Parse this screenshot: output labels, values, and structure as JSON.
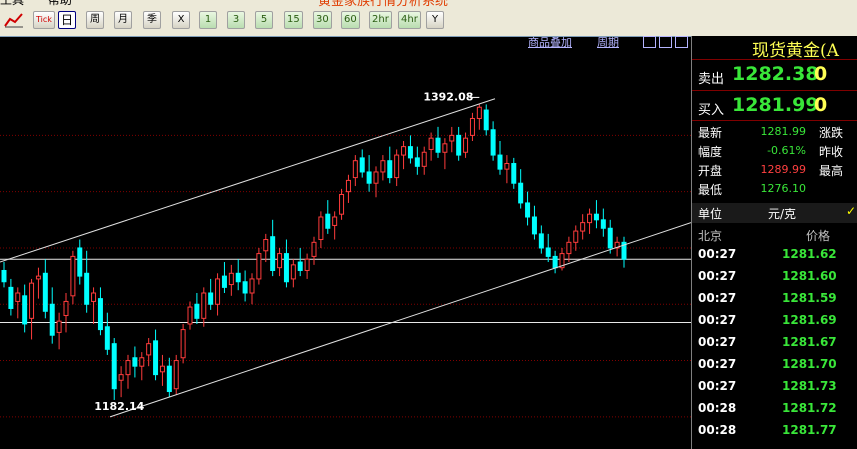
{
  "app": {
    "title": "黄金家族行情分析系统",
    "menu": [
      "工具",
      "帮助"
    ]
  },
  "toolbar": {
    "buttons": [
      {
        "label": "Tick",
        "name": "tick-button"
      },
      {
        "label": "日",
        "name": "period-day-button",
        "selected": true
      },
      {
        "label": "周",
        "name": "period-week-button"
      },
      {
        "label": "月",
        "name": "period-month-button"
      },
      {
        "label": "季",
        "name": "period-quarter-button"
      },
      {
        "label": "X",
        "name": "period-custom-button"
      },
      {
        "label": "1",
        "name": "period-1min-button"
      },
      {
        "label": "3",
        "name": "period-3min-button"
      },
      {
        "label": "5",
        "name": "period-5min-button"
      },
      {
        "label": "15",
        "name": "period-15min-button"
      },
      {
        "label": "30",
        "name": "period-30min-button"
      },
      {
        "label": "60",
        "name": "period-60min-button"
      },
      {
        "label": "2hr",
        "name": "period-2hr-button"
      },
      {
        "label": "4hr",
        "name": "period-4hr-button"
      },
      {
        "label": "Y",
        "name": "period-year-button"
      }
    ]
  },
  "chart_header": {
    "overlay_link": "商品叠加",
    "period_link": "周期"
  },
  "chart_data": {
    "type": "candlestick",
    "high_label": "1392.08",
    "low_label": "1182.14",
    "ylim": [
      1150,
      1420
    ],
    "colors": {
      "up": "#ff3c3c",
      "down": "#00ffff",
      "grid": "#800000",
      "trend": "#e0e0e0"
    },
    "candles": [
      {
        "o": 1274,
        "h": 1280,
        "l": 1262,
        "c": 1266
      },
      {
        "o": 1262,
        "h": 1268,
        "l": 1242,
        "c": 1247
      },
      {
        "o": 1252,
        "h": 1262,
        "l": 1240,
        "c": 1258
      },
      {
        "o": 1256,
        "h": 1264,
        "l": 1230,
        "c": 1236
      },
      {
        "o": 1240,
        "h": 1268,
        "l": 1225,
        "c": 1265
      },
      {
        "o": 1268,
        "h": 1276,
        "l": 1254,
        "c": 1270
      },
      {
        "o": 1272,
        "h": 1282,
        "l": 1240,
        "c": 1245
      },
      {
        "o": 1250,
        "h": 1262,
        "l": 1222,
        "c": 1228
      },
      {
        "o": 1230,
        "h": 1244,
        "l": 1218,
        "c": 1238
      },
      {
        "o": 1242,
        "h": 1258,
        "l": 1230,
        "c": 1252
      },
      {
        "o": 1256,
        "h": 1288,
        "l": 1250,
        "c": 1284
      },
      {
        "o": 1290,
        "h": 1296,
        "l": 1264,
        "c": 1270
      },
      {
        "o": 1272,
        "h": 1288,
        "l": 1244,
        "c": 1250
      },
      {
        "o": 1252,
        "h": 1262,
        "l": 1236,
        "c": 1258
      },
      {
        "o": 1254,
        "h": 1262,
        "l": 1228,
        "c": 1232
      },
      {
        "o": 1234,
        "h": 1244,
        "l": 1214,
        "c": 1218
      },
      {
        "o": 1222,
        "h": 1226,
        "l": 1182,
        "c": 1190
      },
      {
        "o": 1196,
        "h": 1206,
        "l": 1184,
        "c": 1200
      },
      {
        "o": 1200,
        "h": 1214,
        "l": 1190,
        "c": 1210
      },
      {
        "o": 1212,
        "h": 1220,
        "l": 1198,
        "c": 1206
      },
      {
        "o": 1206,
        "h": 1216,
        "l": 1196,
        "c": 1212
      },
      {
        "o": 1214,
        "h": 1226,
        "l": 1206,
        "c": 1222
      },
      {
        "o": 1224,
        "h": 1232,
        "l": 1196,
        "c": 1200
      },
      {
        "o": 1202,
        "h": 1214,
        "l": 1192,
        "c": 1206
      },
      {
        "o": 1206,
        "h": 1212,
        "l": 1184,
        "c": 1188
      },
      {
        "o": 1190,
        "h": 1214,
        "l": 1186,
        "c": 1210
      },
      {
        "o": 1212,
        "h": 1236,
        "l": 1208,
        "c": 1232
      },
      {
        "o": 1236,
        "h": 1252,
        "l": 1232,
        "c": 1248
      },
      {
        "o": 1250,
        "h": 1258,
        "l": 1236,
        "c": 1240
      },
      {
        "o": 1240,
        "h": 1262,
        "l": 1234,
        "c": 1258
      },
      {
        "o": 1258,
        "h": 1268,
        "l": 1246,
        "c": 1250
      },
      {
        "o": 1250,
        "h": 1272,
        "l": 1242,
        "c": 1268
      },
      {
        "o": 1270,
        "h": 1280,
        "l": 1258,
        "c": 1262
      },
      {
        "o": 1264,
        "h": 1278,
        "l": 1256,
        "c": 1272
      },
      {
        "o": 1272,
        "h": 1282,
        "l": 1260,
        "c": 1266
      },
      {
        "o": 1266,
        "h": 1274,
        "l": 1252,
        "c": 1258
      },
      {
        "o": 1258,
        "h": 1272,
        "l": 1250,
        "c": 1268
      },
      {
        "o": 1268,
        "h": 1290,
        "l": 1264,
        "c": 1286
      },
      {
        "o": 1288,
        "h": 1300,
        "l": 1280,
        "c": 1296
      },
      {
        "o": 1298,
        "h": 1310,
        "l": 1270,
        "c": 1274
      },
      {
        "o": 1276,
        "h": 1290,
        "l": 1270,
        "c": 1286
      },
      {
        "o": 1286,
        "h": 1296,
        "l": 1262,
        "c": 1266
      },
      {
        "o": 1268,
        "h": 1282,
        "l": 1262,
        "c": 1278
      },
      {
        "o": 1280,
        "h": 1290,
        "l": 1270,
        "c": 1274
      },
      {
        "o": 1274,
        "h": 1286,
        "l": 1268,
        "c": 1282
      },
      {
        "o": 1284,
        "h": 1298,
        "l": 1278,
        "c": 1294
      },
      {
        "o": 1296,
        "h": 1316,
        "l": 1290,
        "c": 1312
      },
      {
        "o": 1314,
        "h": 1324,
        "l": 1300,
        "c": 1304
      },
      {
        "o": 1306,
        "h": 1316,
        "l": 1296,
        "c": 1312
      },
      {
        "o": 1314,
        "h": 1332,
        "l": 1310,
        "c": 1328
      },
      {
        "o": 1330,
        "h": 1342,
        "l": 1322,
        "c": 1338
      },
      {
        "o": 1340,
        "h": 1356,
        "l": 1334,
        "c": 1352
      },
      {
        "o": 1354,
        "h": 1360,
        "l": 1340,
        "c": 1344
      },
      {
        "o": 1344,
        "h": 1356,
        "l": 1330,
        "c": 1336
      },
      {
        "o": 1336,
        "h": 1348,
        "l": 1326,
        "c": 1344
      },
      {
        "o": 1344,
        "h": 1356,
        "l": 1338,
        "c": 1352
      },
      {
        "o": 1352,
        "h": 1362,
        "l": 1336,
        "c": 1340
      },
      {
        "o": 1340,
        "h": 1360,
        "l": 1334,
        "c": 1356
      },
      {
        "o": 1356,
        "h": 1366,
        "l": 1346,
        "c": 1362
      },
      {
        "o": 1362,
        "h": 1370,
        "l": 1350,
        "c": 1354
      },
      {
        "o": 1354,
        "h": 1362,
        "l": 1342,
        "c": 1348
      },
      {
        "o": 1348,
        "h": 1362,
        "l": 1342,
        "c": 1358
      },
      {
        "o": 1360,
        "h": 1372,
        "l": 1352,
        "c": 1368
      },
      {
        "o": 1368,
        "h": 1376,
        "l": 1354,
        "c": 1358
      },
      {
        "o": 1358,
        "h": 1368,
        "l": 1346,
        "c": 1364
      },
      {
        "o": 1366,
        "h": 1376,
        "l": 1358,
        "c": 1370
      },
      {
        "o": 1370,
        "h": 1376,
        "l": 1352,
        "c": 1356
      },
      {
        "o": 1358,
        "h": 1372,
        "l": 1354,
        "c": 1368
      },
      {
        "o": 1370,
        "h": 1386,
        "l": 1366,
        "c": 1382
      },
      {
        "o": 1382,
        "h": 1392,
        "l": 1374,
        "c": 1390
      },
      {
        "o": 1388,
        "h": 1392,
        "l": 1370,
        "c": 1374
      },
      {
        "o": 1374,
        "h": 1380,
        "l": 1352,
        "c": 1356
      },
      {
        "o": 1356,
        "h": 1366,
        "l": 1342,
        "c": 1346
      },
      {
        "o": 1346,
        "h": 1356,
        "l": 1336,
        "c": 1350
      },
      {
        "o": 1350,
        "h": 1354,
        "l": 1332,
        "c": 1336
      },
      {
        "o": 1336,
        "h": 1346,
        "l": 1318,
        "c": 1322
      },
      {
        "o": 1322,
        "h": 1330,
        "l": 1306,
        "c": 1312
      },
      {
        "o": 1312,
        "h": 1320,
        "l": 1296,
        "c": 1300
      },
      {
        "o": 1300,
        "h": 1306,
        "l": 1286,
        "c": 1290
      },
      {
        "o": 1290,
        "h": 1300,
        "l": 1280,
        "c": 1284
      },
      {
        "o": 1284,
        "h": 1288,
        "l": 1272,
        "c": 1276
      },
      {
        "o": 1276,
        "h": 1290,
        "l": 1274,
        "c": 1286
      },
      {
        "o": 1286,
        "h": 1298,
        "l": 1280,
        "c": 1294
      },
      {
        "o": 1294,
        "h": 1306,
        "l": 1288,
        "c": 1302
      },
      {
        "o": 1302,
        "h": 1314,
        "l": 1296,
        "c": 1308
      },
      {
        "o": 1308,
        "h": 1318,
        "l": 1300,
        "c": 1314
      },
      {
        "o": 1314,
        "h": 1324,
        "l": 1304,
        "c": 1310
      },
      {
        "o": 1310,
        "h": 1318,
        "l": 1298,
        "c": 1304
      },
      {
        "o": 1304,
        "h": 1310,
        "l": 1286,
        "c": 1290
      },
      {
        "o": 1290,
        "h": 1298,
        "l": 1284,
        "c": 1294
      },
      {
        "o": 1294,
        "h": 1298,
        "l": 1276,
        "c": 1282
      }
    ]
  },
  "panel": {
    "title": "现货黄金(A",
    "sell": {
      "label": "卖出",
      "value": "1282.38",
      "volume": "0"
    },
    "buy": {
      "label": "买入",
      "value": "1281.99",
      "volume": "0"
    },
    "stats": [
      {
        "label": "最新",
        "value": "1281.99",
        "color": "#39e639",
        "right": "涨跌"
      },
      {
        "label": "幅度",
        "value": "-0.61%",
        "color": "#39e639",
        "right": "昨收"
      },
      {
        "label": "开盘",
        "value": "1289.99",
        "color": "#ff4040",
        "right": "最高"
      },
      {
        "label": "最低",
        "value": "1276.10",
        "color": "#39e639",
        "right": ""
      }
    ],
    "unit": {
      "label": "单位",
      "value": "元/克",
      "check": "✓"
    },
    "ticks_header": {
      "time": "北京",
      "price": "价格"
    },
    "ticks": [
      {
        "time": "00:27",
        "price": "1281.62"
      },
      {
        "time": "00:27",
        "price": "1281.60"
      },
      {
        "time": "00:27",
        "price": "1281.59"
      },
      {
        "time": "00:27",
        "price": "1281.69"
      },
      {
        "time": "00:27",
        "price": "1281.67"
      },
      {
        "time": "00:27",
        "price": "1281.70"
      },
      {
        "time": "00:27",
        "price": "1281.73"
      },
      {
        "time": "00:28",
        "price": "1281.72"
      },
      {
        "time": "00:28",
        "price": "1281.77"
      }
    ]
  }
}
